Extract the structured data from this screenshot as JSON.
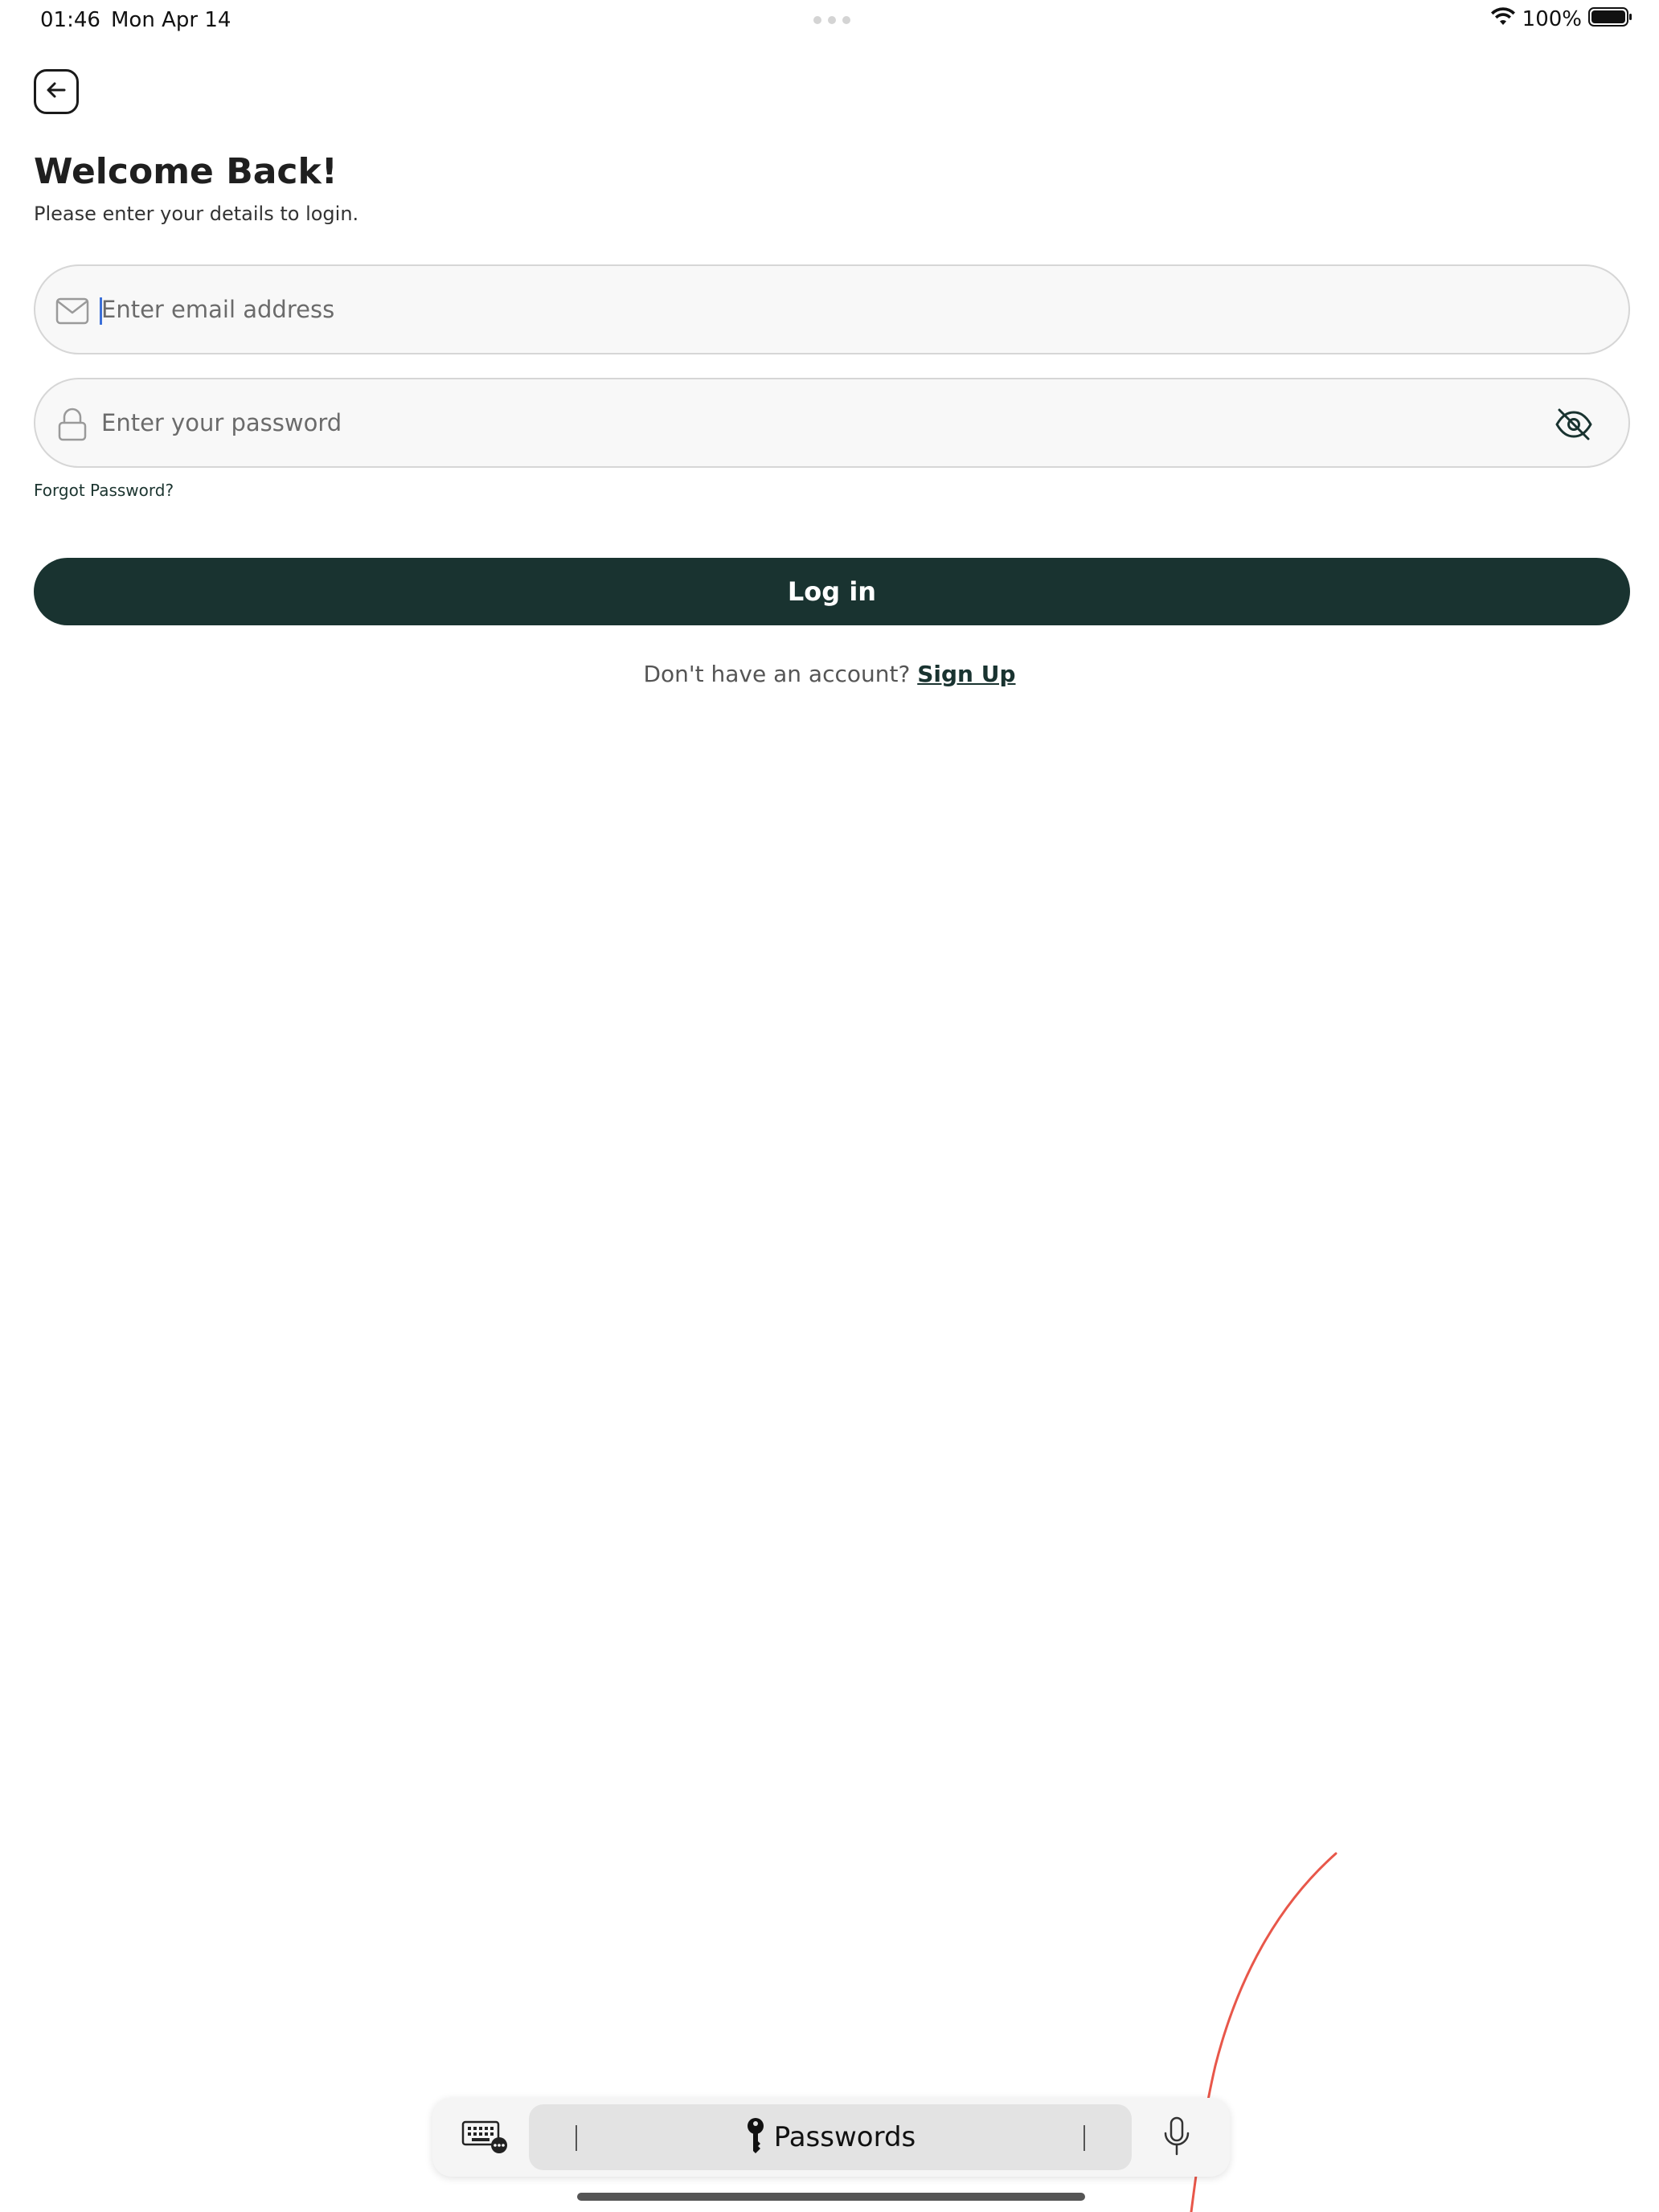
{
  "status_bar": {
    "time": "01:46",
    "date": "Mon Apr 14",
    "battery_percent": "100%",
    "icons": [
      "wifi-icon",
      "battery-icon"
    ]
  },
  "header": {
    "back_icon": "arrow-left-icon",
    "title": "Welcome Back!",
    "subtitle": "Please enter your details to login."
  },
  "form": {
    "email": {
      "placeholder": "Enter email address",
      "value": "",
      "icon": "mail-icon"
    },
    "password": {
      "placeholder": "Enter your password",
      "value": "",
      "icon": "lock-icon",
      "toggle_icon": "eye-off-icon"
    },
    "forgot_label": "Forgot Password?",
    "login_label": "Log in",
    "signup_prompt": "Don't have an account?",
    "signup_label": "Sign Up"
  },
  "keyboard_bar": {
    "passwords_label": "Passwords",
    "icons": [
      "keyboard-icon",
      "key-icon",
      "microphone-icon"
    ]
  },
  "colors": {
    "primary": "#193330",
    "field_bg": "#f8f8f8",
    "field_border": "#d6d6d6",
    "annotation": "#e8574a"
  }
}
